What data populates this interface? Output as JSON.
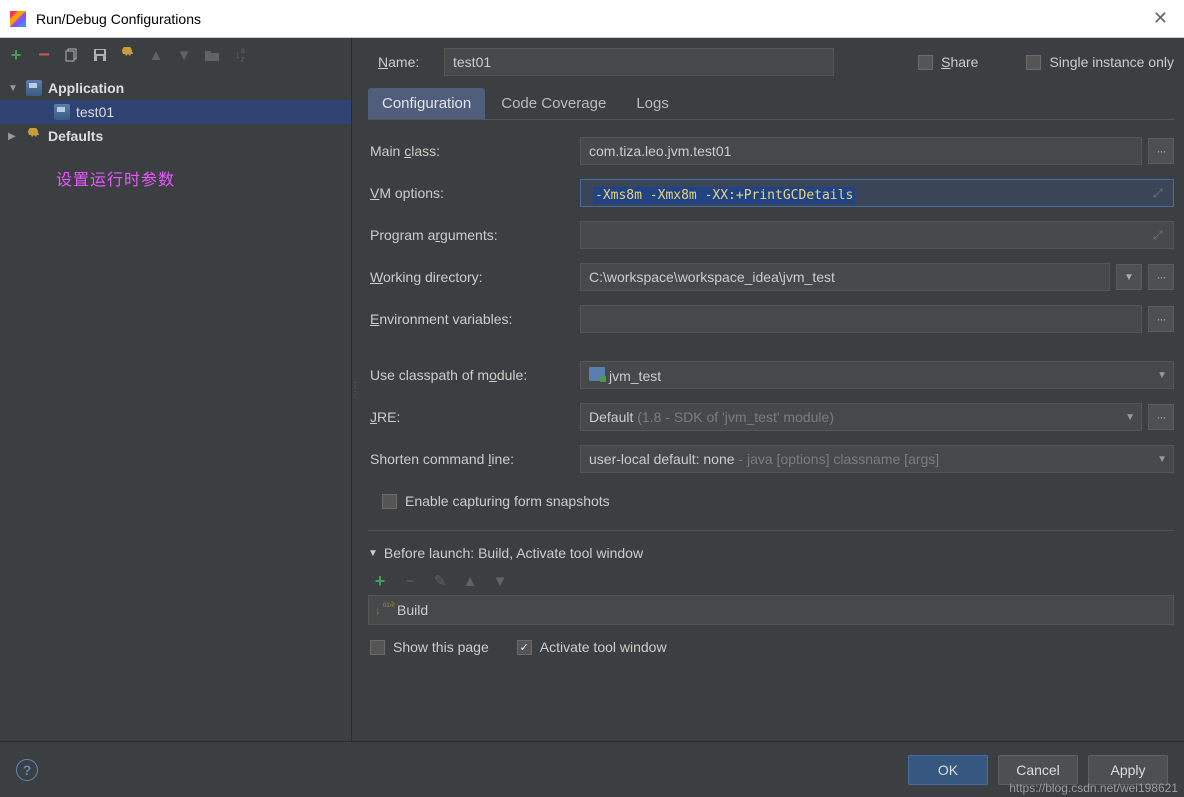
{
  "window": {
    "title": "Run/Debug Configurations"
  },
  "topbar": {
    "name_label": "Name:",
    "name_value": "test01",
    "share_label": "Share",
    "single_instance_label": "Single instance only"
  },
  "tree": {
    "application_label": "Application",
    "config_item_label": "test01",
    "defaults_label": "Defaults"
  },
  "annotation": "设置运行时参数",
  "tabs": {
    "configuration": "Configuration",
    "code_coverage": "Code Coverage",
    "logs": "Logs"
  },
  "form": {
    "main_class_label": "Main class:",
    "main_class_value": "com.tiza.leo.jvm.test01",
    "vm_options_label": "VM options:",
    "vm_options_value": "-Xms8m -Xmx8m -XX:+PrintGCDetails",
    "program_args_label": "Program arguments:",
    "working_dir_label": "Working directory:",
    "working_dir_value": "C:\\workspace\\workspace_idea\\jvm_test",
    "env_vars_label": "Environment variables:",
    "classpath_module_label": "Use classpath of module:",
    "classpath_module_value": "jvm_test",
    "jre_label": "JRE:",
    "jre_value": "Default",
    "jre_hint": " (1.8 - SDK of 'jvm_test' module)",
    "shorten_cmd_label": "Shorten command line:",
    "shorten_cmd_value": "user-local default: none",
    "shorten_cmd_hint": " - java [options] classname [args]",
    "enable_snapshots_label": "Enable capturing form snapshots"
  },
  "before_launch": {
    "header": "Before launch: Build, Activate tool window",
    "build_item": "Build",
    "show_page_label": "Show this page",
    "activate_window_label": "Activate tool window"
  },
  "footer": {
    "ok": "OK",
    "cancel": "Cancel",
    "apply": "Apply"
  },
  "watermark": "https://blog.csdn.net/wei198621"
}
